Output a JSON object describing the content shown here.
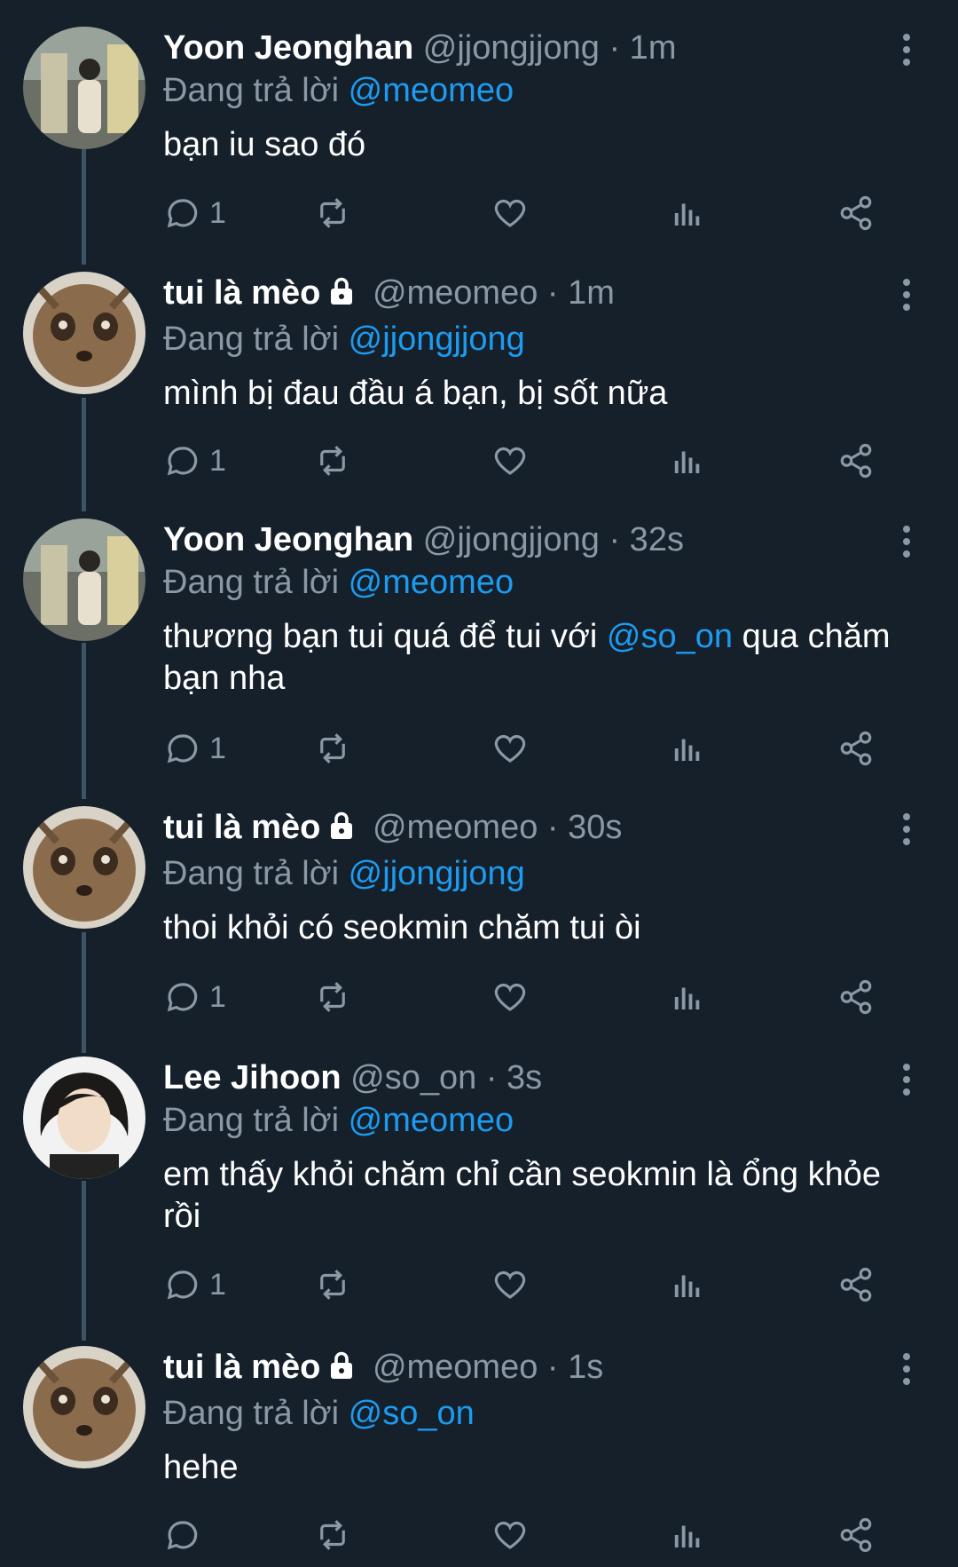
{
  "colors": {
    "background": "#15202b",
    "text": "#ffffff",
    "muted": "#8b98a5",
    "accent": "#1d9bf0",
    "thread_line": "#3d5466"
  },
  "replying_label": "Đang trả lời",
  "icons": {
    "reply": "reply-icon",
    "retweet": "retweet-icon",
    "like": "heart-icon",
    "views": "views-icon",
    "share": "share-icon",
    "more": "more-icon",
    "lock": "lock-icon"
  },
  "tweets": [
    {
      "name": "Yoon Jeonghan",
      "handle": "@jjongjjong",
      "time": "· 1m",
      "locked": false,
      "reply_to": "@meomeo",
      "text_before": "bạn iu sao đó",
      "text_mention": "",
      "text_after": "",
      "reply_count": "1",
      "avatar": "person-photo"
    },
    {
      "name": "tui là mèo",
      "handle": "@meomeo",
      "time": "· 1m",
      "locked": true,
      "reply_to": "@jjongjjong",
      "text_before": "mình bị đau đầu á bạn, bị sốt nữa",
      "text_mention": "",
      "text_after": "",
      "reply_count": "1",
      "avatar": "cat-photo"
    },
    {
      "name": "Yoon Jeonghan",
      "handle": "@jjongjjong",
      "time": "· 32s",
      "locked": false,
      "reply_to": "@meomeo",
      "text_before": "thương bạn tui quá để tui với ",
      "text_mention": "@so_on",
      "text_after": " qua chăm bạn nha",
      "reply_count": "1",
      "avatar": "person-photo"
    },
    {
      "name": "tui là mèo",
      "handle": "@meomeo",
      "time": "· 30s",
      "locked": true,
      "reply_to": "@jjongjjong",
      "text_before": "thoi khỏi có seokmin chăm tui òi",
      "text_mention": "",
      "text_after": "",
      "reply_count": "1",
      "avatar": "cat-photo"
    },
    {
      "name": "Lee Jihoon",
      "handle": "@so_on",
      "time": "· 3s",
      "locked": false,
      "reply_to": "@meomeo",
      "text_before": "em thấy khỏi chăm chỉ cần seokmin là ổng khỏe rồi",
      "text_mention": "",
      "text_after": "",
      "reply_count": "1",
      "avatar": "person-photo-2"
    },
    {
      "name": "tui là mèo",
      "handle": "@meomeo",
      "time": "· 1s",
      "locked": true,
      "reply_to": "@so_on",
      "text_before": "hehe",
      "text_mention": "",
      "text_after": "",
      "reply_count": "",
      "avatar": "cat-photo"
    }
  ]
}
